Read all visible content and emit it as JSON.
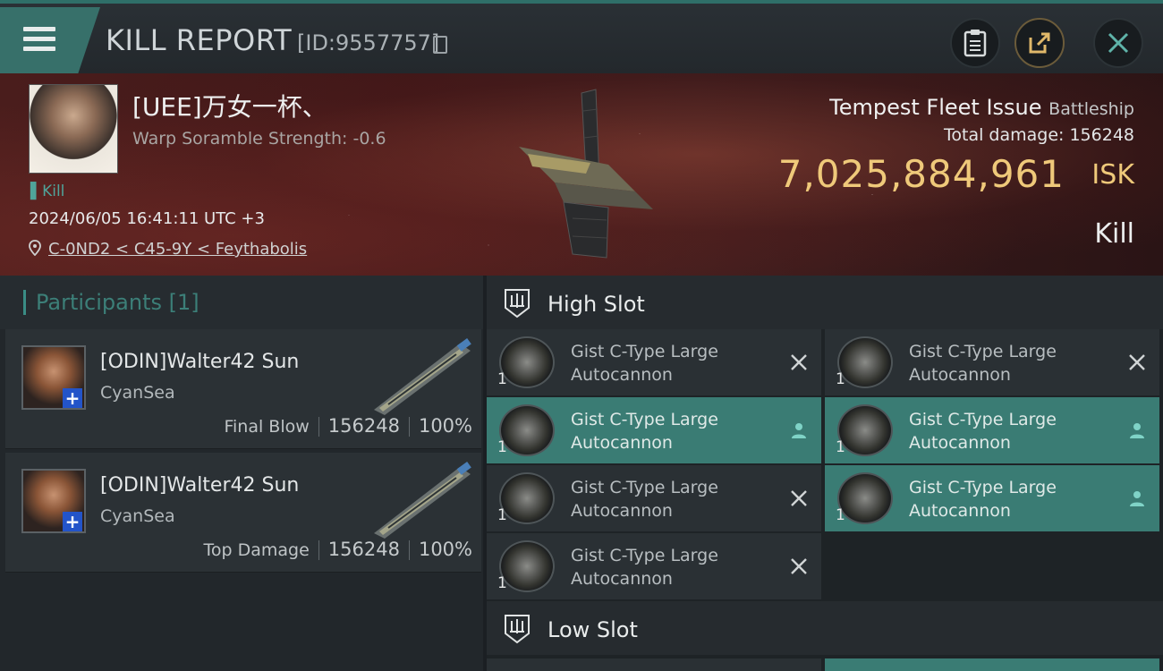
{
  "header": {
    "title": "KILL REPORT",
    "report_id": "[ID:9557757]"
  },
  "victim": {
    "name": "[UEE]万女一杯、",
    "scramble": "Warp Soramble Strength: -0.6",
    "tag": "Kill",
    "datetime": "2024/06/05 16:41:11 UTC +3",
    "location": "C-0ND2 < C45-9Y < Feythabolis",
    "ship": "Tempest Fleet Issue",
    "ship_class": "Battleship",
    "total_damage_label": "Total damage:",
    "total_damage": "156248",
    "isk_value": "7,025,884,961",
    "isk_unit": "ISK",
    "status": "Kill"
  },
  "participants": {
    "title": "Participants [1]",
    "rows": [
      {
        "name": "[ODIN]Walter42 Sun",
        "corp": "CyanSea",
        "role": "Final Blow",
        "damage": "156248",
        "percent": "100%"
      },
      {
        "name": "[ODIN]Walter42 Sun",
        "corp": "CyanSea",
        "role": "Top Damage",
        "damage": "156248",
        "percent": "100%"
      }
    ]
  },
  "slots": {
    "high": {
      "title": "High Slot",
      "modules": [
        {
          "line1": "Gist C-Type Large",
          "line2": "Autocannon",
          "qty": "1",
          "state": "destroyed"
        },
        {
          "line1": "Gist C-Type Large",
          "line2": "Autocannon",
          "qty": "1",
          "state": "destroyed"
        },
        {
          "line1": "Gist C-Type Large",
          "line2": "Autocannon",
          "qty": "1",
          "state": "dropped"
        },
        {
          "line1": "Gist C-Type Large",
          "line2": "Autocannon",
          "qty": "1",
          "state": "dropped"
        },
        {
          "line1": "Gist C-Type Large",
          "line2": "Autocannon",
          "qty": "1",
          "state": "destroyed"
        },
        {
          "line1": "Gist C-Type Large",
          "line2": "Autocannon",
          "qty": "1",
          "state": "dropped"
        },
        {
          "line1": "Gist C-Type Large",
          "line2": "Autocannon",
          "qty": "1",
          "state": "destroyed"
        }
      ]
    },
    "low": {
      "title": "Low Slot"
    }
  },
  "icons": {
    "menu": "menu-icon",
    "copy": "copy-icon",
    "clipboard": "clipboard-icon",
    "share": "share-icon",
    "close": "close-icon",
    "location": "location-pin-icon",
    "destroyed": "x-mark-icon",
    "dropped": "person-icon"
  },
  "colors": {
    "accent": "#3a8d85",
    "isk": "#efc97a",
    "dropped_bg": "#3a7c74"
  }
}
